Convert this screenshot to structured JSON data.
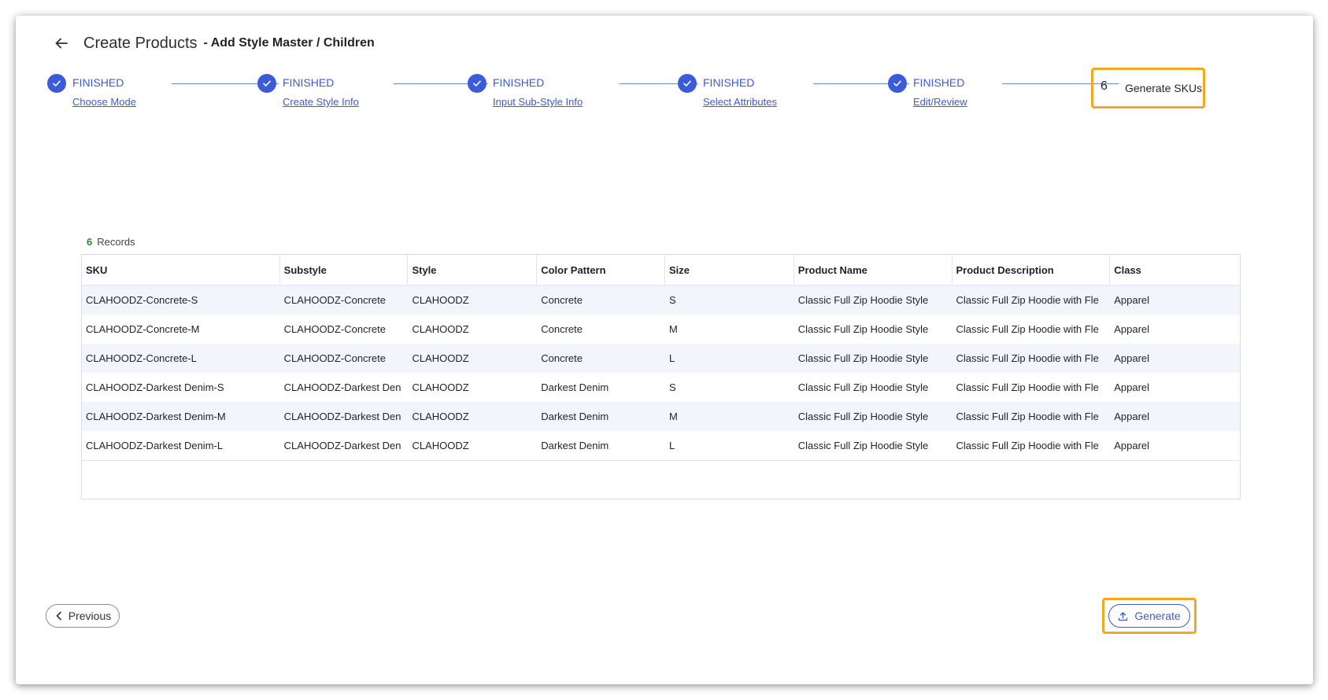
{
  "header": {
    "title": "Create Products",
    "subtitle": "- Add Style Master / Children"
  },
  "stepper": {
    "steps": [
      {
        "status": "FINISHED",
        "label": "Choose Mode"
      },
      {
        "status": "FINISHED",
        "label": "Create Style Info"
      },
      {
        "status": "FINISHED",
        "label": "Input Sub-Style Info"
      },
      {
        "status": "FINISHED",
        "label": "Select Attributes"
      },
      {
        "status": "FINISHED",
        "label": "Edit/Review"
      }
    ],
    "active": {
      "number": "6",
      "label": "Generate SKUs"
    }
  },
  "records": {
    "count": "6",
    "label": "Records"
  },
  "table": {
    "columns": [
      "SKU",
      "Substyle",
      "Style",
      "Color Pattern",
      "Size",
      "Product Name",
      "Product Description",
      "Class"
    ],
    "rows": [
      [
        "CLAHOODZ-Concrete-S",
        "CLAHOODZ-Concrete",
        "CLAHOODZ",
        "Concrete",
        "S",
        "Classic Full Zip Hoodie Style",
        "Classic Full Zip Hoodie with Fle",
        "Apparel"
      ],
      [
        "CLAHOODZ-Concrete-M",
        "CLAHOODZ-Concrete",
        "CLAHOODZ",
        "Concrete",
        "M",
        "Classic Full Zip Hoodie Style",
        "Classic Full Zip Hoodie with Fle",
        "Apparel"
      ],
      [
        "CLAHOODZ-Concrete-L",
        "CLAHOODZ-Concrete",
        "CLAHOODZ",
        "Concrete",
        "L",
        "Classic Full Zip Hoodie Style",
        "Classic Full Zip Hoodie with Fle",
        "Apparel"
      ],
      [
        "CLAHOODZ-Darkest Denim-S",
        "CLAHOODZ-Darkest Den",
        "CLAHOODZ",
        "Darkest Denim",
        "S",
        "Classic Full Zip Hoodie Style",
        "Classic Full Zip Hoodie with Fle",
        "Apparel"
      ],
      [
        "CLAHOODZ-Darkest Denim-M",
        "CLAHOODZ-Darkest Den",
        "CLAHOODZ",
        "Darkest Denim",
        "M",
        "Classic Full Zip Hoodie Style",
        "Classic Full Zip Hoodie with Fle",
        "Apparel"
      ],
      [
        "CLAHOODZ-Darkest Denim-L",
        "CLAHOODZ-Darkest Den",
        "CLAHOODZ",
        "Darkest Denim",
        "L",
        "Classic Full Zip Hoodie Style",
        "Classic Full Zip Hoodie with Fle",
        "Apparel"
      ]
    ]
  },
  "footer": {
    "previous_label": "Previous",
    "generate_label": "Generate"
  },
  "icons": {
    "back": "arrow-left-icon",
    "check": "check-icon",
    "previous": "chevron-left-icon",
    "generate": "upload-icon"
  },
  "colors": {
    "accent": "#3b5bdb",
    "highlight": "#f5a623",
    "records_count": "#2e8b2e",
    "row_alt": "#f2f6fc"
  }
}
